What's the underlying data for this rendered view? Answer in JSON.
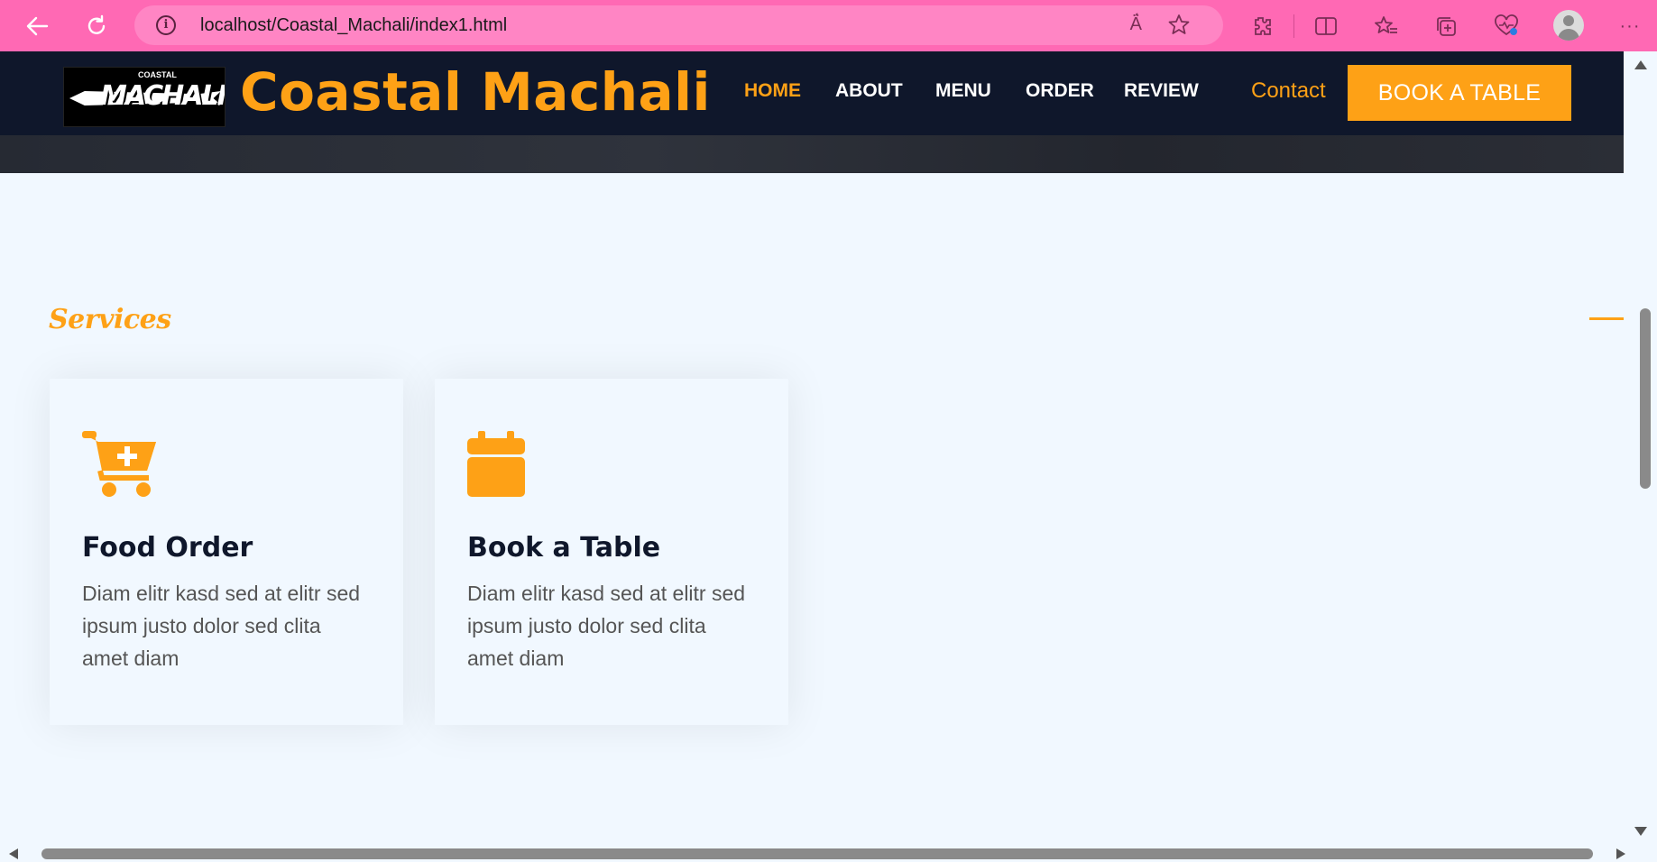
{
  "browser": {
    "url": "localhost/Coastal_Machali/index1.html",
    "icons": [
      "back-arrow-icon",
      "refresh-icon",
      "site-info-icon",
      "read-aloud-icon",
      "favorite-star-icon",
      "extensions-icon",
      "split-screen-icon",
      "favorites-icon",
      "collections-icon",
      "browser-essentials-icon",
      "profile-icon",
      "more-icon"
    ],
    "read_aloud_label": "Ä́",
    "info_label": "i"
  },
  "navbar": {
    "logo_text": "MACHALI",
    "logo_subtext": "COASTAL",
    "brand": "Coastal Machali",
    "items": [
      {
        "label": "HOME",
        "active": true
      },
      {
        "label": "ABOUT",
        "active": false
      },
      {
        "label": "MENU",
        "active": false
      },
      {
        "label": "ORDER",
        "active": false
      },
      {
        "label": "REVIEW",
        "active": false
      }
    ],
    "contact": "Contact",
    "book_button": "BOOK A TABLE"
  },
  "services": {
    "label": "Services",
    "cards": [
      {
        "icon": "cart-plus-icon",
        "title": "Food Order",
        "text": "Diam elitr kasd sed at elitr sed ipsum justo dolor sed clita amet diam"
      },
      {
        "icon": "calendar-icon",
        "title": "Book a Table",
        "text": "Diam elitr kasd sed at elitr sed ipsum justo dolor sed clita amet diam"
      }
    ]
  },
  "colors": {
    "accent": "#fea116",
    "navbar": "#0f172b",
    "browser_bar": "#ff69b4",
    "page_bg": "#f1f8ff"
  }
}
